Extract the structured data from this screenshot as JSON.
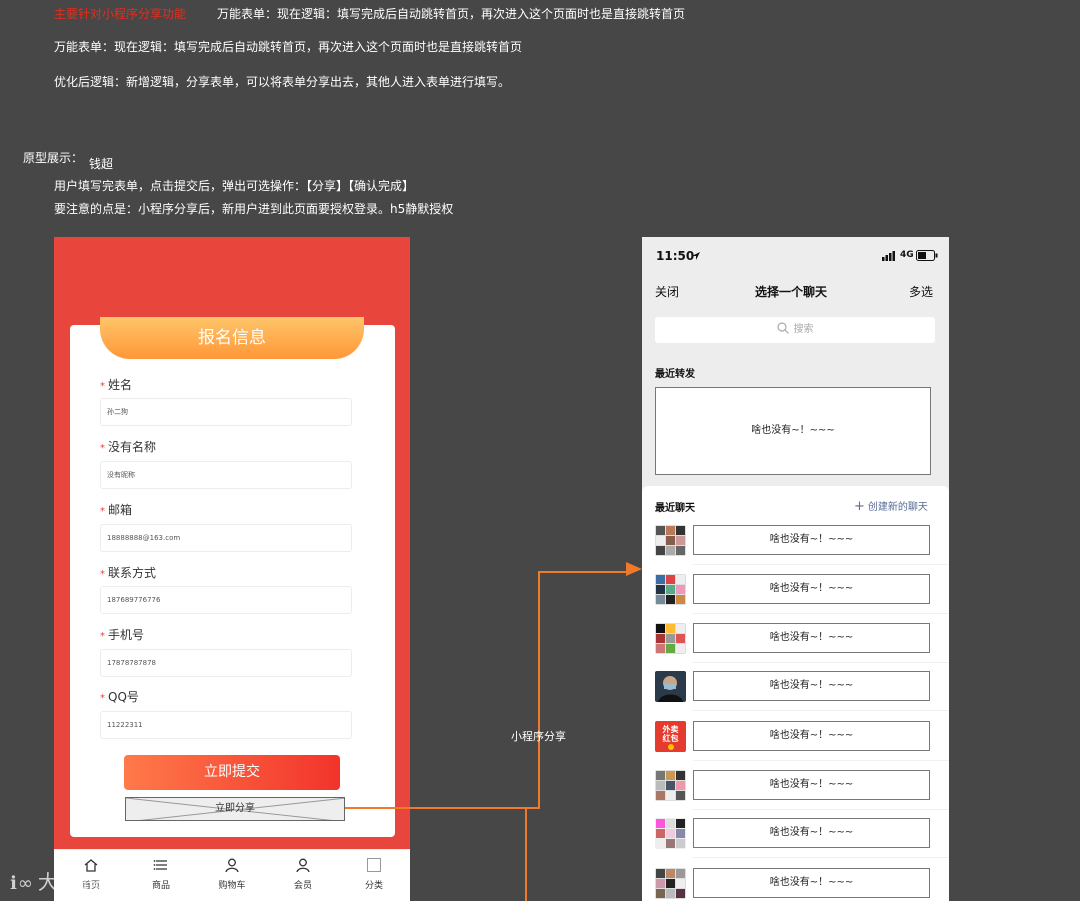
{
  "notes": {
    "top_red": "主要针对小程序分享功能",
    "line1": "万能表单：现在逻辑：填写完成后自动跳转首页，再次进入这个页面时也是直接跳转首页",
    "line2": "万能表单：现在逻辑：填写完成后自动跳转首页，再次进入这个页面时也是直接跳转首页",
    "line3": "优化后逻辑：新增逻辑，分享表单，可以将表单分享出去，其他人进入表单进行填写。",
    "prototype_label": "原型展示：",
    "author": "钱超",
    "line4": "用户填写完表单，点击提交后，弹出可选操作：【分享】【确认完成】",
    "line5": "要注意的点是：小程序分享后，新用户进到此页面要授权登录。h5静默授权"
  },
  "form": {
    "title": "报名信息",
    "required_mark": "*",
    "fields": [
      {
        "label": "姓名",
        "value": "孙二狗"
      },
      {
        "label": "没有名称",
        "value": "没有昵称"
      },
      {
        "label": "邮箱",
        "value": "18888888@163.com"
      },
      {
        "label": "联系方式",
        "value": "187689776776"
      },
      {
        "label": "手机号",
        "value": "17878787878"
      },
      {
        "label": "QQ号",
        "value": "11222311"
      }
    ],
    "submit_label": "立即提交",
    "share_label": "立即分享"
  },
  "tabbar": {
    "items": [
      {
        "label": "首页",
        "icon": "home-icon"
      },
      {
        "label": "商品",
        "icon": "list-icon"
      },
      {
        "label": "购物车",
        "icon": "person-icon"
      },
      {
        "label": "会员",
        "icon": "person-icon"
      },
      {
        "label": "分类",
        "icon": "square-icon"
      }
    ]
  },
  "flow": {
    "label": "小程序分享",
    "color": "#f07a2a"
  },
  "share_sheet": {
    "time": "11:50",
    "network": "4G",
    "close_label": "关闭",
    "title": "选择一个聊天",
    "multi_label": "多选",
    "search_placeholder": "搜索",
    "recent_forward_label": "最近转发",
    "recent_forward_empty": "啥也没有~！~~~",
    "recent_chats_label": "最近聊天",
    "create_chat_label": "创建新的聊天",
    "chats": [
      {
        "text": "啥也没有~！~~~"
      },
      {
        "text": "啥也没有~！~~~"
      },
      {
        "text": "啥也没有~！~~~"
      },
      {
        "text": "啥也没有~！~~~"
      },
      {
        "text": "啥也没有~！~~~"
      },
      {
        "text": "啥也没有~！~~~"
      },
      {
        "text": "啥也没有~！~~~"
      },
      {
        "text": "啥也没有~！~~~"
      }
    ],
    "food_avatar_text": [
      "外卖",
      "红包"
    ]
  },
  "watermark": "大数跨境",
  "colors": {
    "background": "#474747",
    "brand_red": "#e8453c",
    "banner_orange": "#ff9738",
    "accent_blue": "#576b95"
  }
}
